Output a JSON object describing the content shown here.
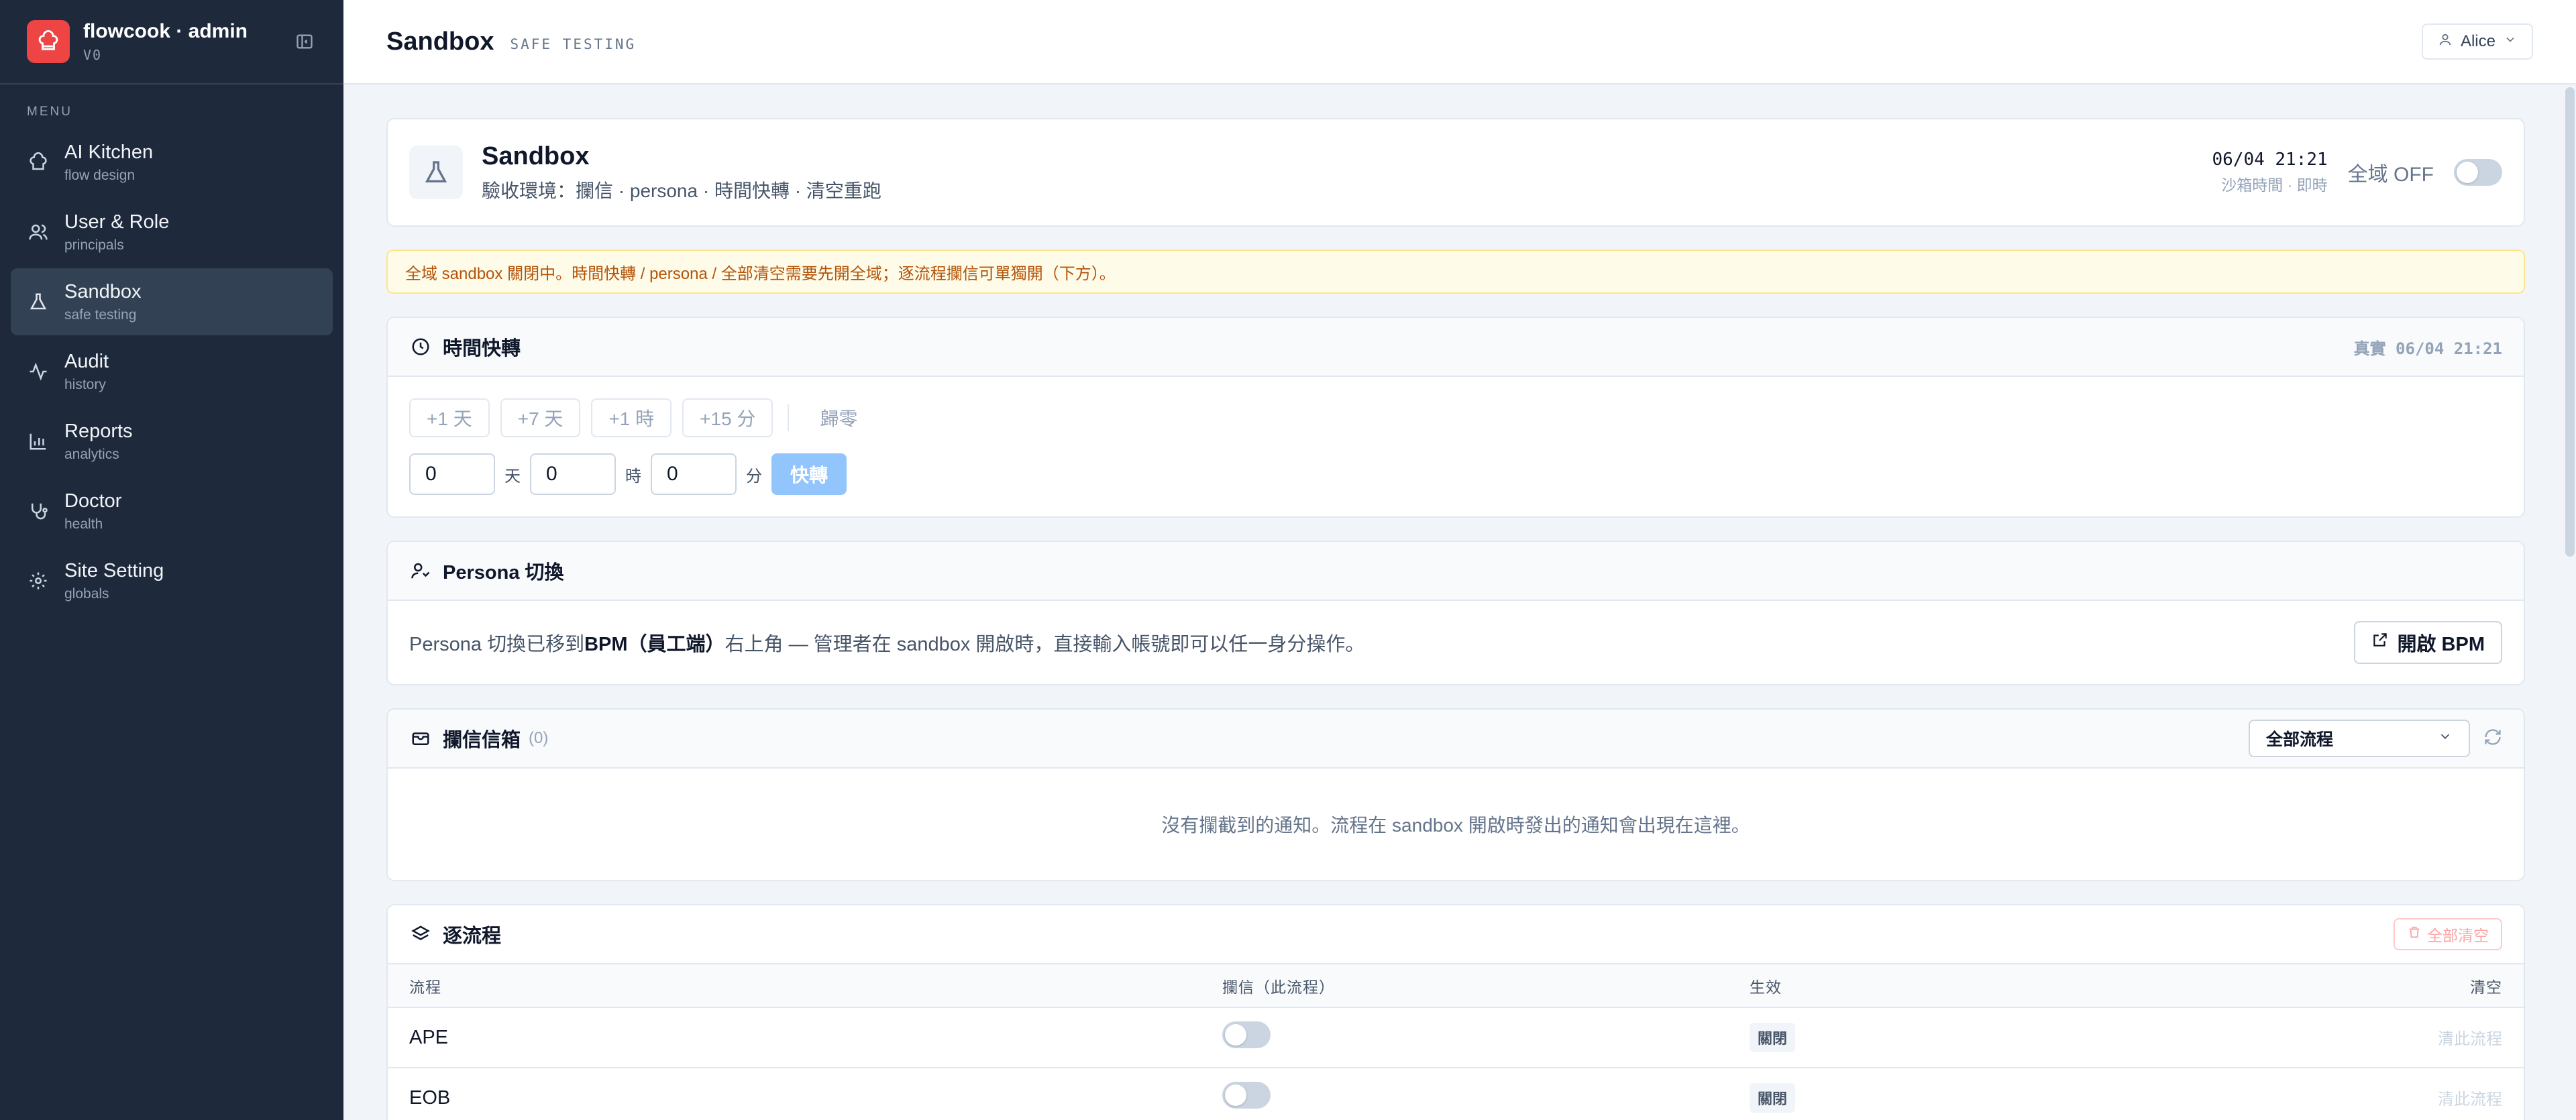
{
  "brand": {
    "title": "flowcook · admin",
    "version": "V0"
  },
  "menu_label": "MENU",
  "sidebar": {
    "items": [
      {
        "label": "AI Kitchen",
        "sub": "flow design",
        "icon": "chef-hat-icon"
      },
      {
        "label": "User & Role",
        "sub": "principals",
        "icon": "users-icon"
      },
      {
        "label": "Sandbox",
        "sub": "safe testing",
        "icon": "flask-icon",
        "active": true
      },
      {
        "label": "Audit",
        "sub": "history",
        "icon": "activity-icon"
      },
      {
        "label": "Reports",
        "sub": "analytics",
        "icon": "bar-chart-icon"
      },
      {
        "label": "Doctor",
        "sub": "health",
        "icon": "stethoscope-icon"
      },
      {
        "label": "Site Setting",
        "sub": "globals",
        "icon": "gear-icon"
      }
    ]
  },
  "topbar": {
    "title": "Sandbox",
    "subtitle": "SAFE TESTING",
    "user": "Alice"
  },
  "hero": {
    "title": "Sandbox",
    "subtitle": "驗收環境：攔信 · persona · 時間快轉 · 清空重跑",
    "clock_time": "06/04 21:21",
    "clock_sub": "沙箱時間 · 即時",
    "global_label": "全域 OFF"
  },
  "alert": "全域 sandbox 關閉中。時間快轉 / persona / 全部清空需要先開全域；逐流程攔信可單獨開（下方）。",
  "time_ff": {
    "title": "時間快轉",
    "real_time": "真實 06/04 21:21",
    "quick": [
      "+1 天",
      "+7 天",
      "+1 時",
      "+15 分"
    ],
    "reset": "歸零",
    "days": "0",
    "days_unit": "天",
    "hours": "0",
    "hours_unit": "時",
    "minutes": "0",
    "minutes_unit": "分",
    "go": "快轉"
  },
  "persona": {
    "title": "Persona 切換",
    "text_before": "Persona 切換已移到 ",
    "text_bold": "BPM（員工端）",
    "text_after": "右上角 — 管理者在 sandbox 開啟時，直接輸入帳號即可以任一身分操作。",
    "open_btn": "開啟 BPM"
  },
  "inbox": {
    "title": "攔信信箱",
    "count": "(0)",
    "filter": "全部流程",
    "empty": "沒有攔截到的通知。流程在 sandbox 開啟時發出的通知會出現在這裡。"
  },
  "per_flow": {
    "title": "逐流程",
    "clear_all": "全部清空",
    "columns": [
      "流程",
      "攔信（此流程）",
      "生效",
      "清空"
    ],
    "rows": [
      {
        "name": "APE",
        "intercept": false,
        "status": "關閉",
        "clear": "清此流程"
      },
      {
        "name": "EOB",
        "intercept": false,
        "status": "關閉",
        "clear": "清此流程"
      }
    ]
  },
  "colors": {
    "brand": "#ef4444",
    "sidebar_bg": "#1e293b",
    "accent": "#93c5fd",
    "alert_text": "#b45309"
  }
}
